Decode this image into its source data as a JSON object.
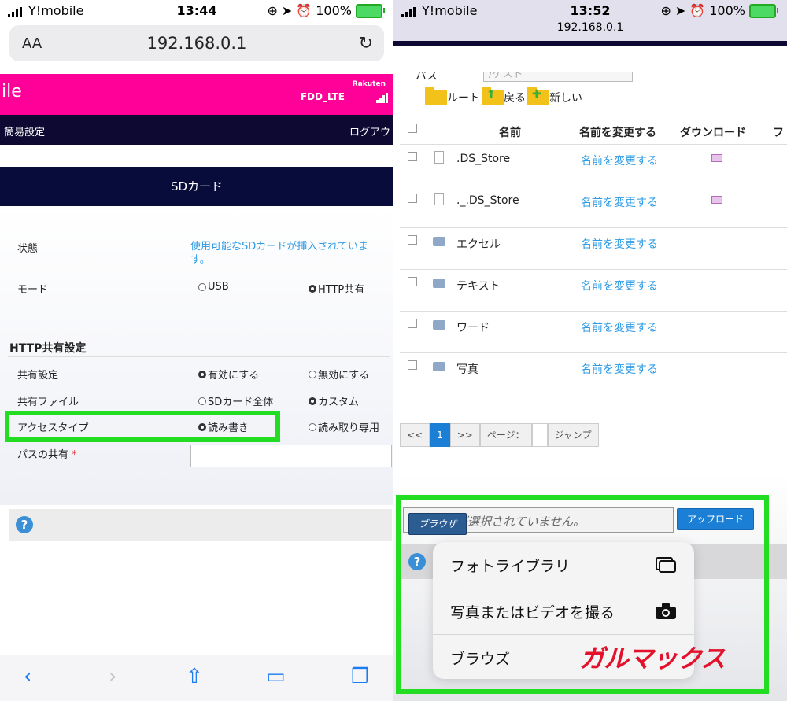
{
  "left": {
    "status": {
      "carrier": "Y!mobile",
      "time": "13:44",
      "battery": "100%"
    },
    "url_bar": {
      "text_size": "AA",
      "address": "192.168.0.1"
    },
    "router_header": {
      "brand": "ile",
      "network": "FDD_LTE",
      "operator": "Rakuten"
    },
    "nav": {
      "left": "簡易設定",
      "right": "ログアウ"
    },
    "section_title": "SDカード",
    "fields": {
      "state_label": "状態",
      "state_value": "使用可能なSDカードが挿入されています。",
      "mode_label": "モード",
      "mode_opt1": "USB",
      "mode_opt2": "HTTP共有",
      "http_heading": "HTTP共有設定",
      "share_label": "共有設定",
      "share_opt1": "有効にする",
      "share_opt2": "無効にする",
      "file_label": "共有ファイル",
      "file_opt1": "SDカード全体",
      "file_opt2": "カスタム",
      "access_label": "アクセスタイプ",
      "access_opt1": "読み書き",
      "access_opt2": "読み取り専用",
      "path_label": "パスの共有",
      "required_mark": "*"
    },
    "help": "?"
  },
  "right": {
    "status": {
      "carrier": "Y!mobile",
      "time": "13:52",
      "battery": "100%",
      "address": "192.168.0.1"
    },
    "path": {
      "label": "パス",
      "placeholder": "/ゲスト"
    },
    "folder_buttons": {
      "root": "ルート",
      "back": "戻る",
      "new": "新しい"
    },
    "table": {
      "headers": {
        "name": "名前",
        "rename": "名前を変更する",
        "download": "ダウンロード",
        "more": "フ"
      },
      "rows": [
        {
          "name": ".DS_Store",
          "rename": "名前を変更する",
          "type": "file"
        },
        {
          "name": "._.DS_Store",
          "rename": "名前を変更する",
          "type": "file"
        },
        {
          "name": "エクセル",
          "rename": "名前を変更する",
          "type": "folder"
        },
        {
          "name": "テキスト",
          "rename": "名前を変更する",
          "type": "folder"
        },
        {
          "name": "ワード",
          "rename": "名前を変更する",
          "type": "folder"
        },
        {
          "name": "写真",
          "rename": "名前を変更する",
          "type": "folder"
        }
      ]
    },
    "pager": {
      "prev": "<<",
      "current": "1",
      "next": ">>",
      "page_label": "ページ：",
      "jump": "ジャンプ"
    },
    "upload": {
      "file_placeholder": "ファイルが選択されていません。",
      "browse": "ブラウザ",
      "upload": "アップロード"
    },
    "menu": {
      "photo_library": "フォトライブラリ",
      "take_photo": "写真またはビデオを撮る",
      "browse": "ブラウズ"
    },
    "help": "?",
    "watermark": "ガルマックス"
  },
  "colors": {
    "accent": "#22dd22",
    "pink": "#ff0099",
    "navy": "#0d0933",
    "link": "#2e9be6"
  }
}
